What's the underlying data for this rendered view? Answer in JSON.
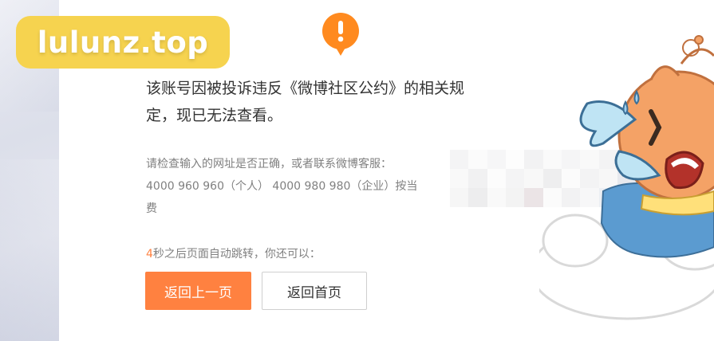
{
  "watermark": {
    "text": "lulunz.top"
  },
  "alert_icon": {
    "name": "exclamation-icon",
    "color": "#ff8a1f"
  },
  "message": {
    "title_line1": "该账号因被投诉违反《微博社区公约》的相关规",
    "title_line2": "定，现已无法查看。",
    "hint_line1": "请检查输入的网址是否正确，或者联系微博客服：",
    "hint_line2": "4000 960 960（个人） 4000 980 980（企业）按当",
    "hint_line3": "费"
  },
  "countdown": {
    "seconds": "4",
    "text": "秒之后页面自动跳转，你还可以："
  },
  "buttons": {
    "back_label": "返回上一页",
    "home_label": "返回首页"
  },
  "colors": {
    "accent": "#ff8140",
    "text_dark": "#333333",
    "text_muted": "#808080"
  },
  "decoration": {
    "mascot": "crying-mascot-illustration",
    "blurred_region": "pixelated-mosaic"
  }
}
